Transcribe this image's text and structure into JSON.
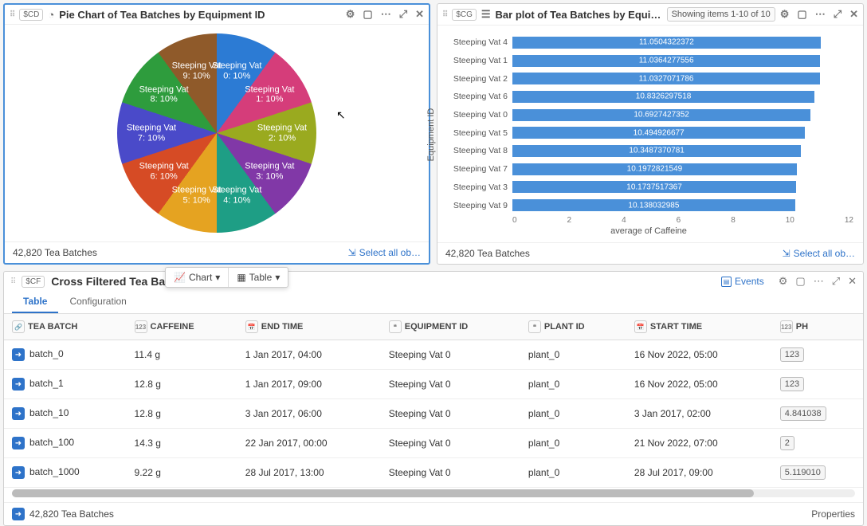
{
  "pie_panel": {
    "tag": "$CD",
    "title": "Pie Chart of Tea Batches by Equipment ID",
    "footer_count": "42,820 Tea Batches",
    "select_all": "Select all ob…"
  },
  "bar_panel": {
    "tag": "$CG",
    "title": "Bar plot of Tea Batches by Equipment",
    "subtitle": "Showing items 1-10 of 10",
    "footer_count": "42,820 Tea Batches",
    "select_all": "Select all ob…",
    "ylabel": "Equipment ID",
    "xlabel": "average of Caffeine"
  },
  "bottom_panel": {
    "tag": "$CF",
    "title": "Cross Filtered Tea Batche",
    "events": "Events",
    "chart_btn": "Chart",
    "table_btn": "Table",
    "tabs": [
      "Table",
      "Configuration"
    ],
    "footer_count": "42,820 Tea Batches",
    "properties": "Properties"
  },
  "columns": [
    "TEA BATCH",
    "CAFFEINE",
    "END TIME",
    "EQUIPMENT ID",
    "PLANT ID",
    "START TIME",
    "PH"
  ],
  "col_icons": [
    "link",
    "123",
    "cal",
    "quote",
    "quote",
    "cal",
    "123"
  ],
  "rows": [
    {
      "batch": "batch_0",
      "caffeine": "11.4 g",
      "end": "1 Jan 2017, 04:00",
      "equip": "Steeping Vat 0",
      "plant": "plant_0",
      "start": "16 Nov 2022, 05:00",
      "ph": "123"
    },
    {
      "batch": "batch_1",
      "caffeine": "12.8 g",
      "end": "1 Jan 2017, 09:00",
      "equip": "Steeping Vat 0",
      "plant": "plant_0",
      "start": "16 Nov 2022, 05:00",
      "ph": "123"
    },
    {
      "batch": "batch_10",
      "caffeine": "12.8 g",
      "end": "3 Jan 2017, 06:00",
      "equip": "Steeping Vat 0",
      "plant": "plant_0",
      "start": "3 Jan 2017, 02:00",
      "ph": "4.841038"
    },
    {
      "batch": "batch_100",
      "caffeine": "14.3 g",
      "end": "22 Jan 2017, 00:00",
      "equip": "Steeping Vat 0",
      "plant": "plant_0",
      "start": "21 Nov 2022, 07:00",
      "ph": "2"
    },
    {
      "batch": "batch_1000",
      "caffeine": "9.22 g",
      "end": "28 Jul 2017, 13:00",
      "equip": "Steeping Vat 0",
      "plant": "plant_0",
      "start": "28 Jul 2017, 09:00",
      "ph": "5.119010"
    }
  ],
  "chart_data": [
    {
      "type": "pie",
      "title": "Pie Chart of Tea Batches by Equipment ID",
      "series": [
        {
          "label": "Steeping Vat 0",
          "pct": 10
        },
        {
          "label": "Steeping Vat 1",
          "pct": 10
        },
        {
          "label": "Steeping Vat 2",
          "pct": 10
        },
        {
          "label": "Steeping Vat 3",
          "pct": 10
        },
        {
          "label": "Steeping Vat 4",
          "pct": 10
        },
        {
          "label": "Steeping Vat 5",
          "pct": 10
        },
        {
          "label": "Steeping Vat 6",
          "pct": 10
        },
        {
          "label": "Steeping Vat 7",
          "pct": 10
        },
        {
          "label": "Steeping Vat 8",
          "pct": 10
        },
        {
          "label": "Steeping Vat 9",
          "pct": 10
        }
      ],
      "colors": [
        "#2c7bd4",
        "#d53d7a",
        "#9aaa1f",
        "#8138a7",
        "#1e9e85",
        "#e5a321",
        "#d64b25",
        "#4a4ac9",
        "#2e9c3d",
        "#8f5a2a"
      ]
    },
    {
      "type": "bar",
      "orientation": "horizontal",
      "title": "Bar plot of Tea Batches by Equipment",
      "xlabel": "average of Caffeine",
      "ylabel": "Equipment ID",
      "xlim": [
        0,
        12
      ],
      "xticks": [
        0,
        2,
        4,
        6,
        8,
        10,
        12
      ],
      "categories": [
        "Steeping Vat 4",
        "Steeping Vat 1",
        "Steeping Vat 2",
        "Steeping Vat 6",
        "Steeping Vat 0",
        "Steeping Vat 5",
        "Steeping Vat 8",
        "Steeping Vat 7",
        "Steeping Vat 3",
        "Steeping Vat 9"
      ],
      "values": [
        11.0504322372,
        11.0364277556,
        11.0327071786,
        10.8326297518,
        10.6927427352,
        10.494926677,
        10.3487370781,
        10.1972821549,
        10.1737517367,
        10.138032985
      ]
    }
  ]
}
